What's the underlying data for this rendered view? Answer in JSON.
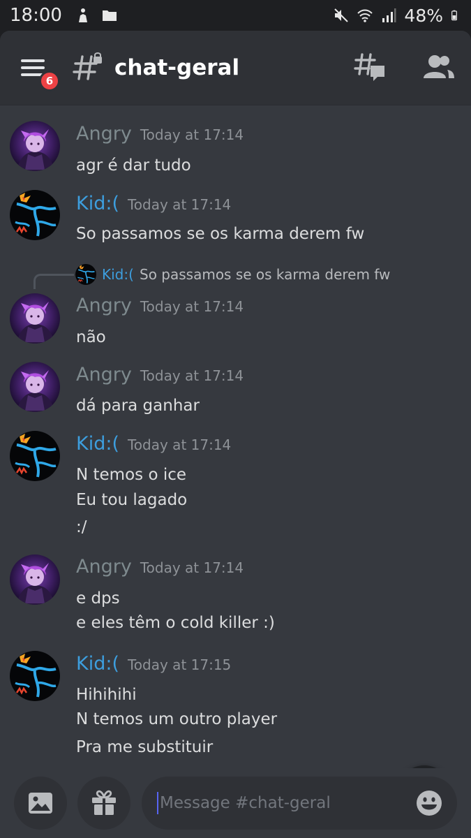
{
  "status_bar": {
    "time": "18:00",
    "battery": "48%",
    "icons": [
      "activity-icon",
      "folder-icon",
      "mute-icon",
      "wifi-icon",
      "signal-icon",
      "battery-icon"
    ]
  },
  "header": {
    "menu_badge": "6",
    "channel_name": "chat-geral",
    "icons": [
      "menu-icon",
      "locked-channel-icon",
      "threads-icon",
      "members-icon"
    ]
  },
  "messages": [
    {
      "author": "Angry",
      "timestamp": "Today at 17:14",
      "lines": [
        "agr é dar tudo"
      ]
    },
    {
      "author": "Kid:(",
      "timestamp": "Today at 17:14",
      "lines": [
        "So passamos se os karma derem fw"
      ]
    },
    {
      "author": "Angry",
      "timestamp": "Today at 17:14",
      "lines": [
        "não"
      ],
      "reply_to": {
        "author": "Kid:(",
        "text": "So passamos se os karma derem fw"
      }
    },
    {
      "author": "Angry",
      "timestamp": "Today at 17:14",
      "lines": [
        "dá para ganhar"
      ]
    },
    {
      "author": "Kid:(",
      "timestamp": "Today at 17:14",
      "lines": [
        "N temos o ice",
        "Eu tou lagado",
        ":/"
      ]
    },
    {
      "author": "Angry",
      "timestamp": "Today at 17:14",
      "lines": [
        "e dps",
        "e eles têm o cold killer :)"
      ]
    },
    {
      "author": "Kid:(",
      "timestamp": "Today at 17:15",
      "lines": [
        "Hihihihi",
        "N temos um outro player",
        "Pra me substituir"
      ]
    }
  ],
  "composer": {
    "placeholder": "Message #chat-geral",
    "icons": [
      "image-icon",
      "gift-icon",
      "emoji-icon"
    ]
  },
  "colors": {
    "background": "#36393f",
    "header": "#2f3136",
    "angry_name": "#7e8a8e",
    "kid_name": "#3d9ede",
    "badge": "#ed4245"
  }
}
